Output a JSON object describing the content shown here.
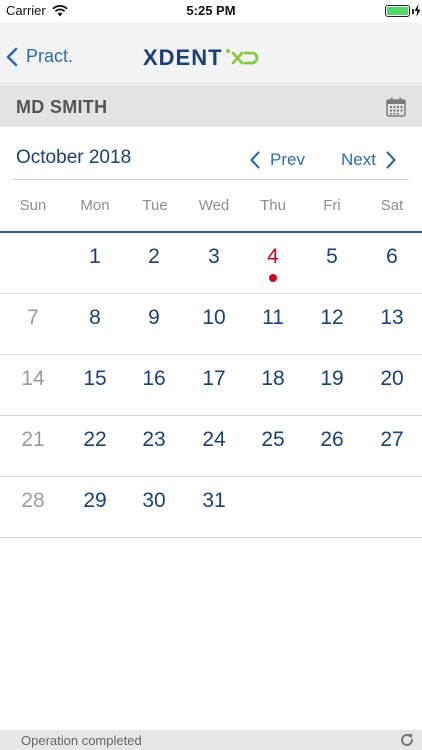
{
  "status_bar": {
    "carrier": "Carrier",
    "time": "5:25 PM",
    "battery_level": 1.0
  },
  "nav": {
    "back_label": "Pract.",
    "logo_text": "XDENT"
  },
  "practitioner": {
    "name": "MD SMITH"
  },
  "calendar": {
    "month_title": "October 2018",
    "prev_label": "Prev",
    "next_label": "Next",
    "weekdays": [
      "Sun",
      "Mon",
      "Tue",
      "Wed",
      "Thu",
      "Fri",
      "Sat"
    ],
    "today": "4",
    "weeks": [
      [
        "",
        "1",
        "2",
        "3",
        "4",
        "5",
        "6"
      ],
      [
        "7",
        "8",
        "9",
        "10",
        "11",
        "12",
        "13"
      ],
      [
        "14",
        "15",
        "16",
        "17",
        "18",
        "19",
        "20"
      ],
      [
        "21",
        "22",
        "23",
        "24",
        "25",
        "26",
        "27"
      ],
      [
        "28",
        "29",
        "30",
        "31",
        "",
        "",
        ""
      ]
    ]
  },
  "footer": {
    "status_text": "Operation completed"
  },
  "colors": {
    "accent": "#2a6db5",
    "brand_navy": "#1c3f78",
    "brand_green": "#8dc63f",
    "today_red": "#d0021b",
    "muted": "#9b9b9b"
  }
}
